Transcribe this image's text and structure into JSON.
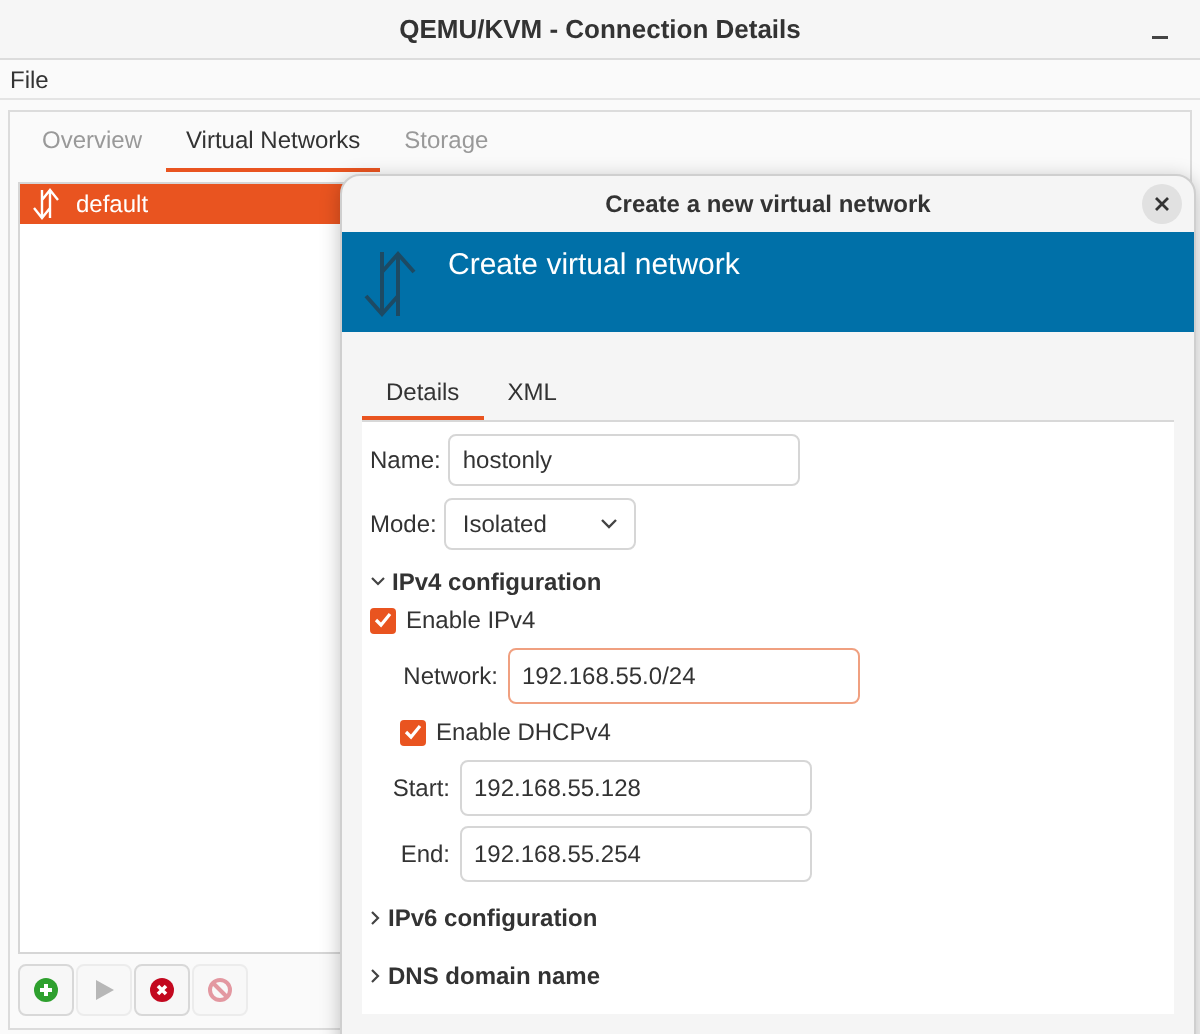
{
  "window": {
    "title": "QEMU/KVM - Connection Details"
  },
  "menu": [
    "File"
  ],
  "tabs": [
    {
      "label": "Overview",
      "selected": false
    },
    {
      "label": "Virtual Networks",
      "selected": true
    },
    {
      "label": "Storage",
      "selected": false
    }
  ],
  "networks": [
    {
      "name": "default",
      "selected": true
    }
  ],
  "toolbar": [
    {
      "kind": "add",
      "disabled": false
    },
    {
      "kind": "start",
      "disabled": true
    },
    {
      "kind": "delete",
      "disabled": false
    },
    {
      "kind": "stop",
      "disabled": true
    }
  ],
  "dialog": {
    "title": "Create a new virtual network",
    "banner_title": "Create virtual network",
    "tabs": [
      {
        "label": "Details",
        "selected": true
      },
      {
        "label": "XML",
        "selected": false
      }
    ],
    "name_field": {
      "label": "Name:",
      "value": "hostonly"
    },
    "mode_field": {
      "label": "Mode:",
      "value": "Isolated"
    },
    "sections": [
      {
        "title": "IPv4 configuration",
        "expanded": true,
        "rows": [
          {
            "kind": "checkbox",
            "label": "Enable IPv4",
            "checked": true
          },
          {
            "kind": "field",
            "label": "Network:",
            "value": "192.168.55.0/24",
            "focused": true
          },
          {
            "kind": "checkbox",
            "label": "Enable DHCPv4",
            "checked": true
          },
          {
            "kind": "field",
            "label": "Start:",
            "value": "192.168.55.128",
            "focused": false
          },
          {
            "kind": "field",
            "label": "End:",
            "value": "192.168.55.254",
            "focused": false
          }
        ]
      },
      {
        "title": "IPv6 configuration",
        "expanded": false
      },
      {
        "title": "DNS domain name",
        "expanded": false
      }
    ]
  }
}
